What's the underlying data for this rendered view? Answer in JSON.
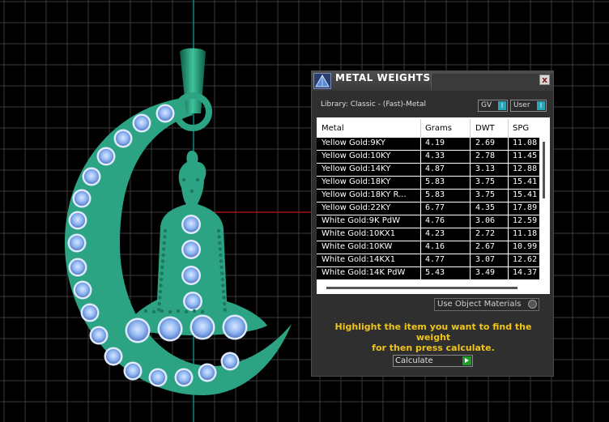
{
  "panel": {
    "title": "METAL WEIGHTS",
    "close_glyph": "x",
    "library_label": "Library: Classic - (Fast)-Metal",
    "toggles": [
      {
        "label": "GV",
        "value": "I"
      },
      {
        "label": "User",
        "value": "I"
      }
    ],
    "table": {
      "columns": [
        "Metal",
        "Grams",
        "DWT",
        "SPG"
      ],
      "rows": [
        [
          "Yellow Gold:9KY",
          "4.19",
          "2.69",
          "11.08"
        ],
        [
          "Yellow Gold:10KY",
          "4.33",
          "2.78",
          "11.45"
        ],
        [
          "Yellow Gold:14KY",
          "4.87",
          "3.13",
          "12.88"
        ],
        [
          "Yellow Gold:18KY",
          "5.83",
          "3.75",
          "15.41"
        ],
        [
          "Yellow Gold:18KY R...",
          "5.83",
          "3.75",
          "15.41"
        ],
        [
          "Yellow Gold:22KY",
          "6.77",
          "4.35",
          "17.89"
        ],
        [
          "White Gold:9K PdW",
          "4.76",
          "3.06",
          "12.59"
        ],
        [
          "White Gold:10KX1",
          "4.23",
          "2.72",
          "11.18"
        ],
        [
          "White Gold:10KW",
          "4.16",
          "2.67",
          "10.99"
        ],
        [
          "White Gold:14KX1",
          "4.77",
          "3.07",
          "12.62"
        ],
        [
          "White Gold:14K PdW",
          "5.43",
          "3.49",
          "14.37"
        ]
      ]
    },
    "materials_select": "Use Object Materials",
    "hint_line1": "Highlight the item you want to find the weight",
    "hint_line2": "for then press calculate.",
    "calculate_label": "Calculate"
  },
  "colors": {
    "viewport_bg": "#000000",
    "grid": "#3a3a3a",
    "axis_cyan": "#13a3a3",
    "axis_red": "#c01818",
    "model_green": "#2ca383",
    "gem": "#8fb6f2",
    "hint_yellow": "#f0c419"
  },
  "icons": {
    "app": "pyramid-icon",
    "close": "close-icon",
    "dropdown": "dropdown-icon",
    "calculate": "play-icon"
  }
}
